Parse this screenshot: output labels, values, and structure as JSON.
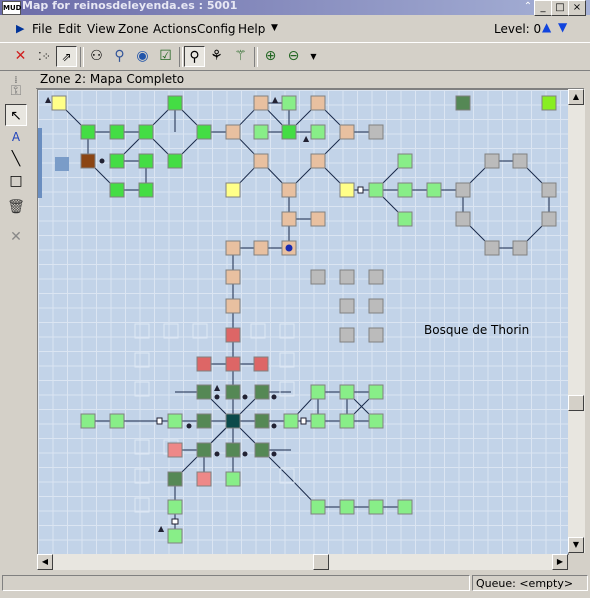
{
  "window": {
    "app_icon_text": "MUD",
    "title": "Map for reinosdeleyenda.es : 5001"
  },
  "menu": {
    "items": [
      "File",
      "Edit",
      "View",
      "Zone",
      "Actions",
      "Config",
      "Help"
    ],
    "level_label": "Level: 0"
  },
  "zone": {
    "title": "Zone 2: Mapa Completo"
  },
  "map": {
    "area_label": "Bosque de Thorin"
  },
  "status": {
    "queue": "Queue: <empty>"
  },
  "colors": {
    "green": "#44dd44",
    "lightgreen": "#88ee88",
    "darkgreen": "#558855",
    "tan": "#e8c0a0",
    "grey": "#bbbbbb",
    "yellow": "#ffff88",
    "red": "#dd6666",
    "pink": "#ee8888",
    "brown": "#8b4513",
    "center": "#0b4a4a"
  }
}
